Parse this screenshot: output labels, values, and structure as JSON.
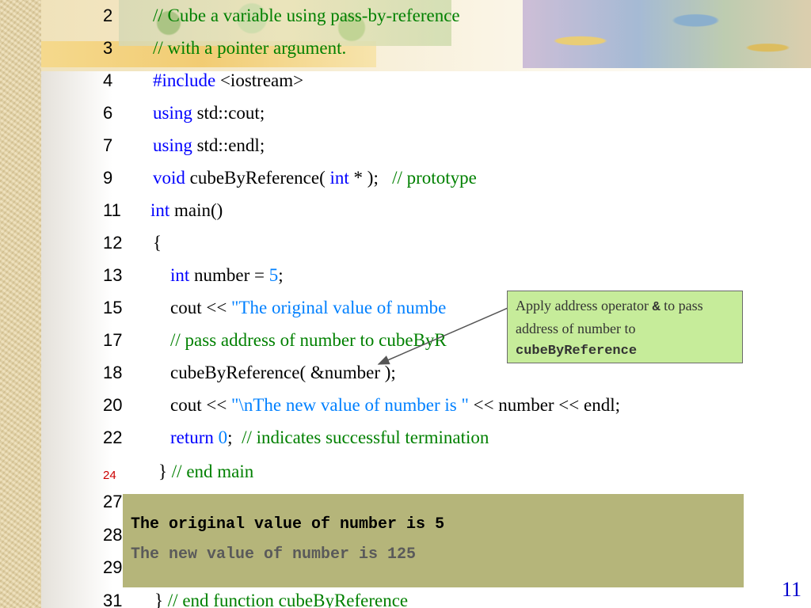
{
  "code": {
    "lines": [
      {
        "number": "2",
        "segments": [
          {
            "text": "// Cube a variable using pass-by-reference",
            "kind": "comment"
          }
        ]
      },
      {
        "number": "3",
        "segments": [
          {
            "text": "// with a pointer argument.",
            "kind": "comment"
          }
        ]
      },
      {
        "number": "4",
        "segments": [
          {
            "text": "#include",
            "kind": "keyword"
          },
          {
            "text": " <iostream>",
            "kind": "plain"
          }
        ]
      },
      {
        "number": "6",
        "segments": [
          {
            "text": "using",
            "kind": "keyword"
          },
          {
            "text": " std::cout;",
            "kind": "plain"
          }
        ]
      },
      {
        "number": "7",
        "segments": [
          {
            "text": "using",
            "kind": "keyword"
          },
          {
            "text": " std::endl;",
            "kind": "plain"
          }
        ]
      },
      {
        "number": "9",
        "segments": [
          {
            "text": "void",
            "kind": "keyword"
          },
          {
            "text": " cubeByReference( ",
            "kind": "plain"
          },
          {
            "text": "int",
            "kind": "keyword"
          },
          {
            "text": " * );   ",
            "kind": "plain"
          },
          {
            "text": "// prototype",
            "kind": "comment"
          }
        ]
      },
      {
        "number": "11",
        "segments": [
          {
            "text": "int",
            "kind": "keyword"
          },
          {
            "text": " main()",
            "kind": "plain"
          }
        ]
      },
      {
        "number": "12",
        "segments": [
          {
            "text": "{",
            "kind": "plain"
          }
        ]
      },
      {
        "number": "13",
        "segments": [
          {
            "text": "int",
            "kind": "keyword"
          },
          {
            "text": " number = ",
            "kind": "plain"
          },
          {
            "text": "5",
            "kind": "number"
          },
          {
            "text": ";",
            "kind": "plain"
          }
        ]
      },
      {
        "number": "15",
        "segments": [
          {
            "text": "cout << ",
            "kind": "plain"
          },
          {
            "text": "\"The original value of numbe",
            "kind": "string"
          }
        ]
      },
      {
        "number": "17",
        "segments": [
          {
            "text": "// pass address of number to cubeByR",
            "kind": "comment"
          }
        ]
      },
      {
        "number": "18",
        "segments": [
          {
            "text": "cubeByReference( &number );",
            "kind": "plain"
          }
        ]
      },
      {
        "number": "20",
        "segments": [
          {
            "text": "cout << ",
            "kind": "plain"
          },
          {
            "text": "\"\\nThe new value of number is \"",
            "kind": "string"
          },
          {
            "text": " << number << endl;",
            "kind": "plain"
          }
        ]
      },
      {
        "number": "22",
        "segments": [
          {
            "text": "return",
            "kind": "keyword"
          },
          {
            "text": " ",
            "kind": "plain"
          },
          {
            "text": "0",
            "kind": "number"
          },
          {
            "text": ";  ",
            "kind": "plain"
          },
          {
            "text": "// indicates successful termination",
            "kind": "comment"
          }
        ]
      },
      {
        "number": "24",
        "segments": [
          {
            "text": "} ",
            "kind": "plain"
          },
          {
            "text": "// end main",
            "kind": "comment"
          }
        ]
      },
      {
        "number": "27",
        "segments": []
      },
      {
        "number": "28",
        "segments": []
      },
      {
        "number": "29",
        "segments": []
      },
      {
        "number": "31",
        "segments": [
          {
            "text": "} ",
            "kind": "plain"
          },
          {
            "text": "// end function cubeByReference",
            "kind": "comment"
          }
        ]
      }
    ]
  },
  "callout": {
    "text_1": "Apply address operator ",
    "operator": "&",
    "text_2": " to pass address of number to ",
    "function_name": "cubeByReference"
  },
  "output": {
    "line_1": "The original value of number is 5",
    "line_2": "The new value of number is 125"
  },
  "slide_number": "11",
  "colors": {
    "keyword": "#0000ff",
    "comment": "#008000",
    "string": "#0080ff",
    "callout_bg": "#c6ec9a",
    "output_bg": "#b5b57a",
    "slide_number": "#0000cc"
  }
}
